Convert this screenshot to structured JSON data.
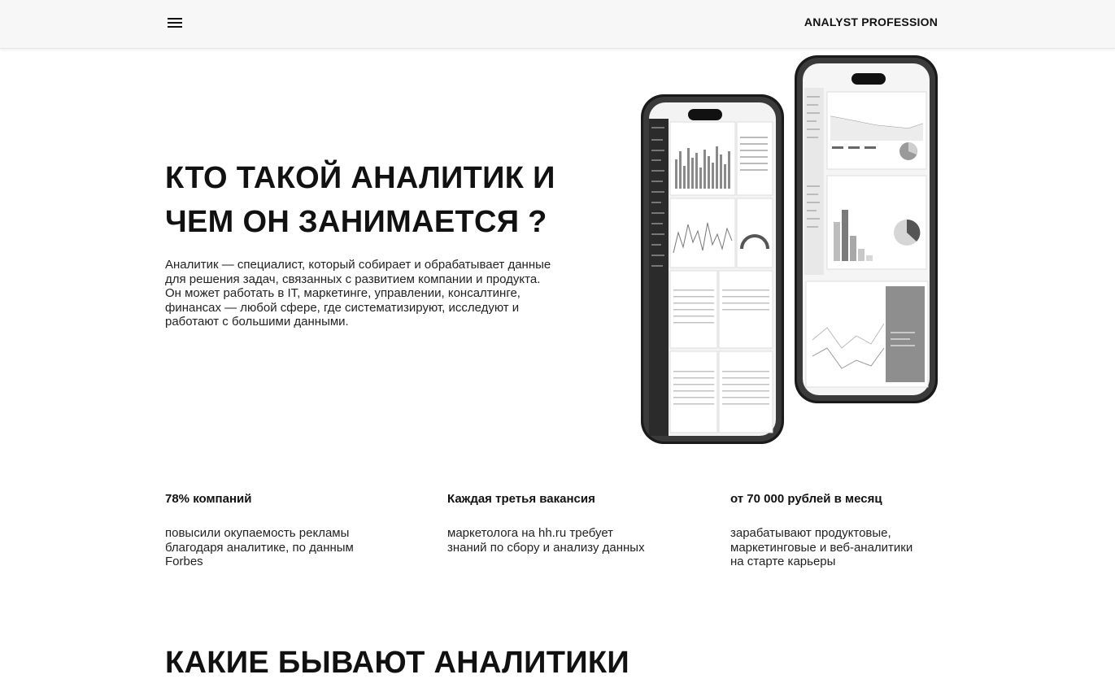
{
  "header": {
    "brand": "ANALYST PROFESSION",
    "menu_icon": "hamburger-menu-icon"
  },
  "hero": {
    "title_line1": "КТО ТАКОЙ АНАЛИТИК И",
    "title_line2": "ЧЕМ ОН ЗАНИМАЕТСЯ ?",
    "text_lines": [
      "Аналитик — специалист, который собирает и обрабатывает данные",
      "для решения задач, связанных с развитием компании и продукта.",
      "Он может работать в IT, маркетинге, управлении, консалтинге,",
      "финансах — любой сфере, где систематизируют, исследуют и",
      "работают с большими данными."
    ]
  },
  "stats": [
    {
      "title": "78% компаний",
      "text_lines": [
        "повысили окупаемость рекламы",
        "благодаря аналитике, по данным",
        "Forbes"
      ]
    },
    {
      "title": "Каждая третья вакансия",
      "text_lines": [
        "маркетолога на hh.ru требует",
        "знаний по сбору и анализу данных"
      ]
    },
    {
      "title": "от 70 000 рублей в месяц",
      "text_lines": [
        "зарабатывают продуктовые,",
        "маркетинговые и веб-аналитики",
        "на старте карьеры"
      ]
    }
  ],
  "section": {
    "title": "КАКИЕ БЫВАЮТ АНАЛИТИКИ"
  }
}
